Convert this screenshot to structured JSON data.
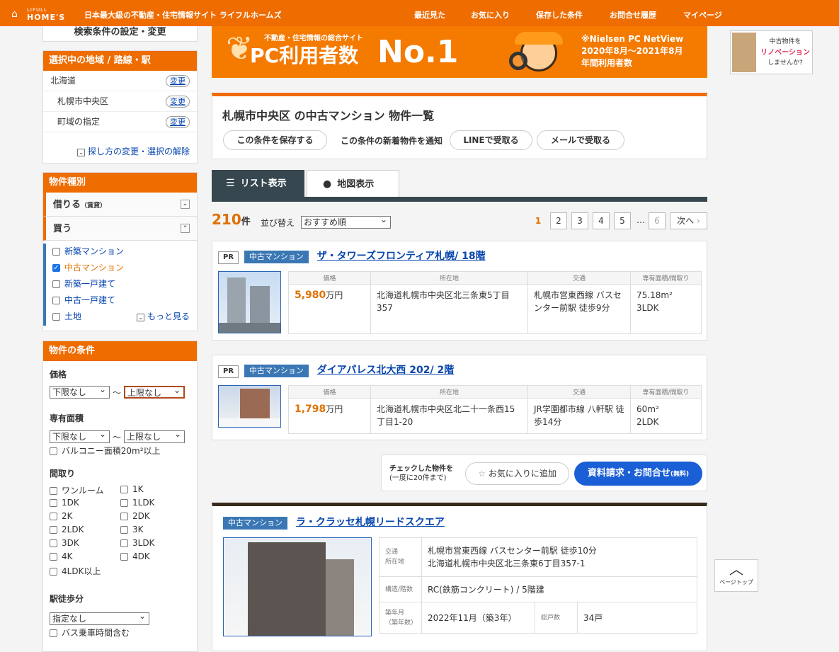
{
  "header": {
    "logo_top": "LIFULL",
    "logo_main": "HOME'S",
    "tagline": "日本最大級の不動産・住宅情報サイト ライフルホームズ",
    "nav": [
      "最近見た",
      "お気に入り",
      "保存した条件",
      "お問合せ履歴",
      "マイページ"
    ]
  },
  "sidebar": {
    "search_settings": "検索条件の設定・変更",
    "area_title": "選択中の地域 / 路線・駅",
    "areas": [
      {
        "label": "北海道",
        "action": "変更"
      },
      {
        "label": "札幌市中央区",
        "action": "変更"
      },
      {
        "label": "町域の指定",
        "action": "変更"
      }
    ],
    "change_method": "探し方の変更・選択の解除",
    "type_title": "物件種別",
    "rent_label": "借りる",
    "rent_sub": "（賃貸）",
    "buy_label": "買う",
    "types": [
      {
        "label": "新築マンション",
        "checked": false
      },
      {
        "label": "中古マンション",
        "checked": true
      },
      {
        "label": "新築一戸建て",
        "checked": false
      },
      {
        "label": "中古一戸建て",
        "checked": false
      },
      {
        "label": "土地",
        "checked": false
      }
    ],
    "more": "もっと見る",
    "cond_title": "物件の条件",
    "price_label": "価格",
    "price_min": "下限なし",
    "price_max": "上限なし",
    "area_label": "専有面積",
    "area_min": "下限なし",
    "area_max": "上限なし",
    "range_sep": "〜",
    "balcony": "バルコニー面積20m²以上",
    "layout_label": "間取り",
    "layouts": [
      "ワンルーム",
      "1K",
      "1DK",
      "1LDK",
      "2K",
      "2DK",
      "2LDK",
      "3K",
      "3DK",
      "3LDK",
      "4K",
      "4DK",
      "4LDK以上"
    ],
    "walk_label": "駅徒歩分",
    "walk_value": "指定なし",
    "bus": "バス乗車時間含む"
  },
  "banner": {
    "sub": "不動産・住宅情報の総合サイト",
    "main": "PC利用者数",
    "no1": "No.1",
    "note1": "※Nielsen PC NetView",
    "note2": "2020年8月～2021年8月",
    "note3": "年間利用者数"
  },
  "side_banner": {
    "line1": "中古物件を",
    "line2": "リノベーション",
    "line3": "しませんか?"
  },
  "list": {
    "title": "札幌市中央区 の中古マンション 物件一覧",
    "save_btn": "この条件を保存する",
    "notify_label": "この条件の新着物件を通知",
    "line_btn": "LINEで受取る",
    "mail_btn": "メールで受取る",
    "tab_list": "リスト表示",
    "tab_map": "地図表示",
    "count": "210",
    "count_unit": "件",
    "sort_label": "並び替え",
    "sort_value": "おすすめ順",
    "pages": [
      "1",
      "2",
      "3",
      "4",
      "5",
      "…",
      "6"
    ],
    "next": "次へ"
  },
  "columns": [
    "価格",
    "所在地",
    "交通",
    "専有面積/間取り"
  ],
  "props": [
    {
      "pr": "PR",
      "kind": "中古マンション",
      "title": "ザ・タワーズフロンティア札幌/ 18階",
      "price": "5,980",
      "unit": "万円",
      "addr": "北海道札幌市中央区北三条東5丁目357",
      "access": "札幌市営東西線 バスセンター前駅 徒歩9分",
      "size": "75.18m²",
      "layout": "3LDK"
    },
    {
      "pr": "PR",
      "kind": "中古マンション",
      "title": "ダイアパレス北大西 202/ 2階",
      "price": "1,798",
      "unit": "万円",
      "addr": "北海道札幌市中央区北二十一条西15丁目1-20",
      "access": "JR学園都市線 八軒駅 徒歩14分",
      "size": "60m²",
      "layout": "2LDK"
    }
  ],
  "actions": {
    "checked_label": "チェックした物件を",
    "checked_sub": "(一度に20件まで)",
    "fav_btn": "お気に入りに追加",
    "inquiry_btn": "資料請求・お問合せ",
    "inquiry_sub": "(無料)"
  },
  "featured": {
    "kind": "中古マンション",
    "title": "ラ・クラッセ札幌リードスクエア",
    "access_lbl": "交通",
    "addr_lbl": "所在地",
    "access": "札幌市営東西線 バスセンター前駅 徒歩10分",
    "addr": "北海道札幌市中央区北三条東6丁目357-1",
    "struct_lbl": "構造/階数",
    "struct": "RC(鉄筋コンクリート) / 5階建",
    "age_lbl": "築年月",
    "age_sub": "（築年数）",
    "age": "2022年11月（築3年）",
    "units_lbl": "総戸数",
    "units": "34戸"
  },
  "page_top": "ページトップ"
}
